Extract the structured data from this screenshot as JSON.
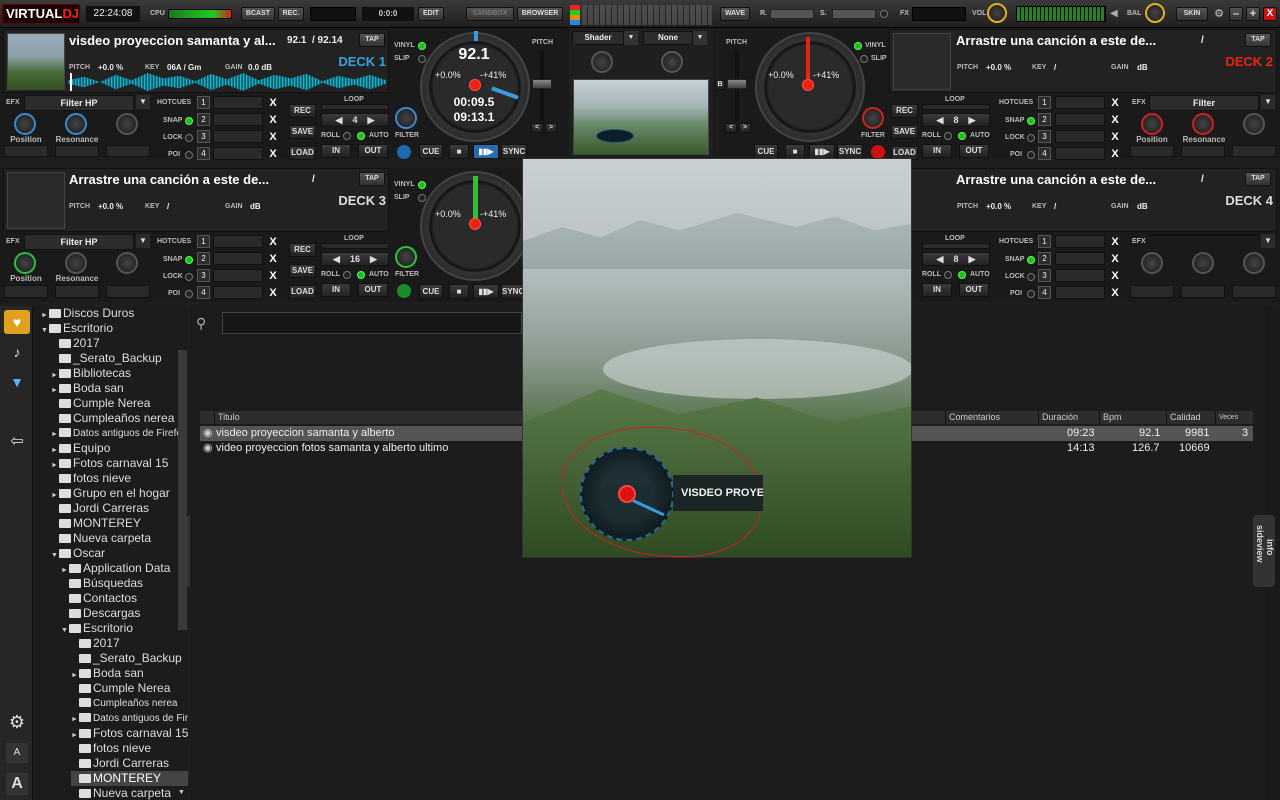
{
  "top": {
    "logo_a": "VIRTUAL",
    "logo_b": "DJ",
    "clock": "22:24:08",
    "cpu": "CPU",
    "bcast": "BCAST",
    "rec": "REC.",
    "rec_time": "0:0:0",
    "edit": "EDIT",
    "sandbox": "SANDBOX",
    "browser": "BROWSER",
    "wave": "WAVE",
    "r": "R.",
    "s": "S.",
    "fx": "FX",
    "vol": "VOL",
    "bal": "BAL",
    "skin": "SKIN"
  },
  "deck1": {
    "title": "visdeo proyeccion samanta y al...",
    "bpm": "92.1",
    "bpm2": "/ 92.14",
    "tap": "TAP",
    "name": "DECK 1",
    "pitch_label": "PITCH",
    "pitch_val": "+0.0 %",
    "key_label": "KEY",
    "key_val": "06A / Gm",
    "gain_label": "GAIN",
    "gain_val": "0.0 dB",
    "efx": "EFX",
    "filter": "Filter HP",
    "k1": "Position",
    "k2": "Resonance",
    "jog_bpm": "92.1",
    "jog_pitch": "+0.0%",
    "jog_range": "-+41%",
    "elapsed": "00:09.5",
    "remain": "09:13.1",
    "loop": "4"
  },
  "deck2": {
    "title": "Arrastre una canción a este de...",
    "slash": "/",
    "tap": "TAP",
    "name": "DECK 2",
    "pitch_label": "PITCH",
    "pitch_val": "+0.0 %",
    "key_label": "KEY",
    "key_val": "/",
    "gain_label": "GAIN",
    "gain_val": "dB",
    "efx": "EFX",
    "filter": "Filter",
    "k1": "Position",
    "k2": "Resonance",
    "jog_pitch": "+0.0%",
    "jog_range": "-+41%",
    "loop": "8"
  },
  "deck3": {
    "title": "Arrastre una canción a este de...",
    "slash": "/",
    "tap": "TAP",
    "name": "DECK 3",
    "pitch_label": "PITCH",
    "pitch_val": "+0.0 %",
    "key_label": "KEY",
    "key_val": "/",
    "gain_label": "GAIN",
    "gain_val": "dB",
    "efx": "EFX",
    "filter": "Filter HP",
    "k1": "Position",
    "k2": "Resonance",
    "jog_pitch": "+0.0%",
    "jog_range": "-+41%",
    "loop": "16"
  },
  "deck4": {
    "title": "Arrastre una canción a este de...",
    "slash": "/",
    "tap": "TAP",
    "name": "DECK 4",
    "pitch_label": "PITCH",
    "pitch_val": "+0.0 %",
    "key_label": "KEY",
    "key_val": "/",
    "gain_label": "GAIN",
    "gain_val": "dB",
    "efx": "EFX",
    "loop": "8"
  },
  "common": {
    "hotcues": "HOTCUES",
    "snap": "SNAP",
    "lock": "LOCK",
    "poi": "POI",
    "x": "X",
    "rec": "REC",
    "save": "SAVE",
    "load": "LOAD",
    "loop": "LOOP",
    "roll": "ROLL",
    "auto": "AUTO",
    "in": "IN",
    "out": "OUT",
    "filter": "FILTER",
    "cue": "CUE",
    "sync": "SYNC",
    "vinyl": "VINYL",
    "slip": "SLIP",
    "pitch": "PITCH",
    "b": "B",
    "lt": "<",
    "gt": ">",
    "n1": "1",
    "n2": "2",
    "n3": "3",
    "n4": "4"
  },
  "video": {
    "shader": "Shader",
    "none": "None",
    "overlay_text": "VISDEO PROYE"
  },
  "tree": [
    {
      "label": "Discos Duros",
      "indent": 0,
      "arrow": "►",
      "sm": false
    },
    {
      "label": "Escritorio",
      "indent": 0,
      "arrow": "▼",
      "sm": false
    },
    {
      "label": "2017",
      "indent": 1,
      "arrow": "",
      "sm": false
    },
    {
      "label": "_Serato_Backup",
      "indent": 1,
      "arrow": "",
      "sm": false
    },
    {
      "label": "Bibliotecas",
      "indent": 1,
      "arrow": "►",
      "sm": false
    },
    {
      "label": "Boda san",
      "indent": 1,
      "arrow": "►",
      "sm": false
    },
    {
      "label": "Cumple Nerea",
      "indent": 1,
      "arrow": "",
      "sm": false
    },
    {
      "label": "Cumpleaños nerea",
      "indent": 1,
      "arrow": "",
      "sm": false
    },
    {
      "label": "Datos antiguos de Firefox",
      "indent": 1,
      "arrow": "►",
      "sm": true
    },
    {
      "label": "Equipo",
      "indent": 1,
      "arrow": "►",
      "sm": false
    },
    {
      "label": "Fotos carnaval 15",
      "indent": 1,
      "arrow": "►",
      "sm": false
    },
    {
      "label": "fotos nieve",
      "indent": 1,
      "arrow": "",
      "sm": false
    },
    {
      "label": "Grupo en el hogar",
      "indent": 1,
      "arrow": "►",
      "sm": false
    },
    {
      "label": "Jordi Carreras",
      "indent": 1,
      "arrow": "",
      "sm": false
    },
    {
      "label": "MONTEREY",
      "indent": 1,
      "arrow": "",
      "sm": false
    },
    {
      "label": "Nueva carpeta",
      "indent": 1,
      "arrow": "",
      "sm": false
    },
    {
      "label": "Oscar",
      "indent": 1,
      "arrow": "▼",
      "sm": false
    },
    {
      "label": "Application Data",
      "indent": 2,
      "arrow": "►",
      "sm": false
    },
    {
      "label": "Búsquedas",
      "indent": 2,
      "arrow": "",
      "sm": false
    },
    {
      "label": "Contactos",
      "indent": 2,
      "arrow": "",
      "sm": false
    },
    {
      "label": "Descargas",
      "indent": 2,
      "arrow": "",
      "sm": false
    },
    {
      "label": "Escritorio",
      "indent": 2,
      "arrow": "▼",
      "sm": false
    },
    {
      "label": "2017",
      "indent": 3,
      "arrow": "",
      "sm": false
    },
    {
      "label": "_Serato_Backup",
      "indent": 3,
      "arrow": "",
      "sm": false
    },
    {
      "label": "Boda san",
      "indent": 3,
      "arrow": "►",
      "sm": false
    },
    {
      "label": "Cumple Nerea",
      "indent": 3,
      "arrow": "",
      "sm": false
    },
    {
      "label": "Cumpleaños nerea",
      "indent": 3,
      "arrow": "",
      "sm": true
    },
    {
      "label": "Datos antiguos de Fire",
      "indent": 3,
      "arrow": "►",
      "sm": true
    },
    {
      "label": "Fotos carnaval 15",
      "indent": 3,
      "arrow": "►",
      "sm": false
    },
    {
      "label": "fotos nieve",
      "indent": 3,
      "arrow": "",
      "sm": false
    },
    {
      "label": "Jordi Carreras",
      "indent": 3,
      "arrow": "",
      "sm": false
    },
    {
      "label": "MONTEREY",
      "indent": 3,
      "arrow": "",
      "sm": false,
      "selected": true
    },
    {
      "label": "Nueva carpeta",
      "indent": 3,
      "arrow": "",
      "sm": false
    }
  ],
  "browser": {
    "folders_tab": "folders",
    "sideview_tab": "sideview",
    "info_tab": "info",
    "columns": {
      "titulo": "Titulo",
      "comentarios": "Comentarios",
      "duracion": "Duración",
      "bpm": "Bpm",
      "calidad": "Calidad",
      "veces": "Veces"
    },
    "rows": [
      {
        "title": "visdeo proyeccion samanta y alberto",
        "duration": "09:23",
        "bpm": "92.1",
        "quality": "9981",
        "plays": "3"
      },
      {
        "title": "video proyeccion fotos samanta y alberto ultimo",
        "duration": "14:13",
        "bpm": "126.7",
        "quality": "10669",
        "plays": ""
      }
    ],
    "font_a1": "A",
    "font_a2": "A"
  }
}
